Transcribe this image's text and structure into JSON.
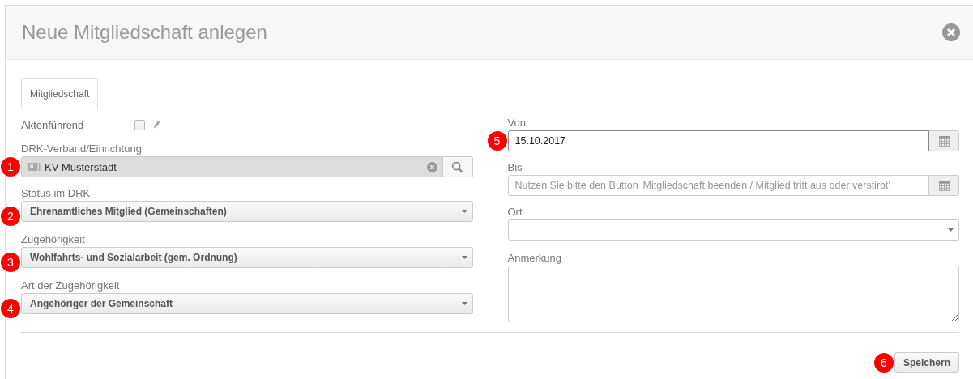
{
  "dialog": {
    "title": "Neue Mitgliedschaft anlegen"
  },
  "tabs": [
    {
      "label": "Mitgliedschaft",
      "selected": true
    }
  ],
  "checkbox_row": {
    "label": "Aktenführend",
    "checked": false
  },
  "left_fields": [
    {
      "kind": "lookup",
      "label": "DRK-Verband/Einrichtung",
      "value": "KV Musterstadt",
      "marker": "1"
    },
    {
      "kind": "select",
      "label": "Status im DRK",
      "value": "Ehrenamtliches Mitglied (Gemeinschaften)",
      "marker": "2"
    },
    {
      "kind": "select",
      "label": "Zugehörigkeit",
      "value": "Wohlfahrts- und Sozialarbeit (gem. Ordnung)",
      "marker": "3"
    },
    {
      "kind": "select",
      "label": "Art der Zugehörigkeit",
      "value": "Angehöriger der Gemeinschaft",
      "marker": "4"
    }
  ],
  "right_fields": [
    {
      "kind": "date",
      "label": "Von",
      "value": "15.10.2017",
      "marker": "5"
    },
    {
      "kind": "date",
      "label": "Bis",
      "placeholder": "Nutzen Sie bitte den Button 'Mitgliedschaft beenden / Mitglied tritt aus oder verstirbt'"
    },
    {
      "kind": "select",
      "label": "Ort"
    },
    {
      "kind": "textarea",
      "label": "Anmerkung"
    }
  ],
  "save_button": {
    "label": "Speichern",
    "marker": "6"
  }
}
